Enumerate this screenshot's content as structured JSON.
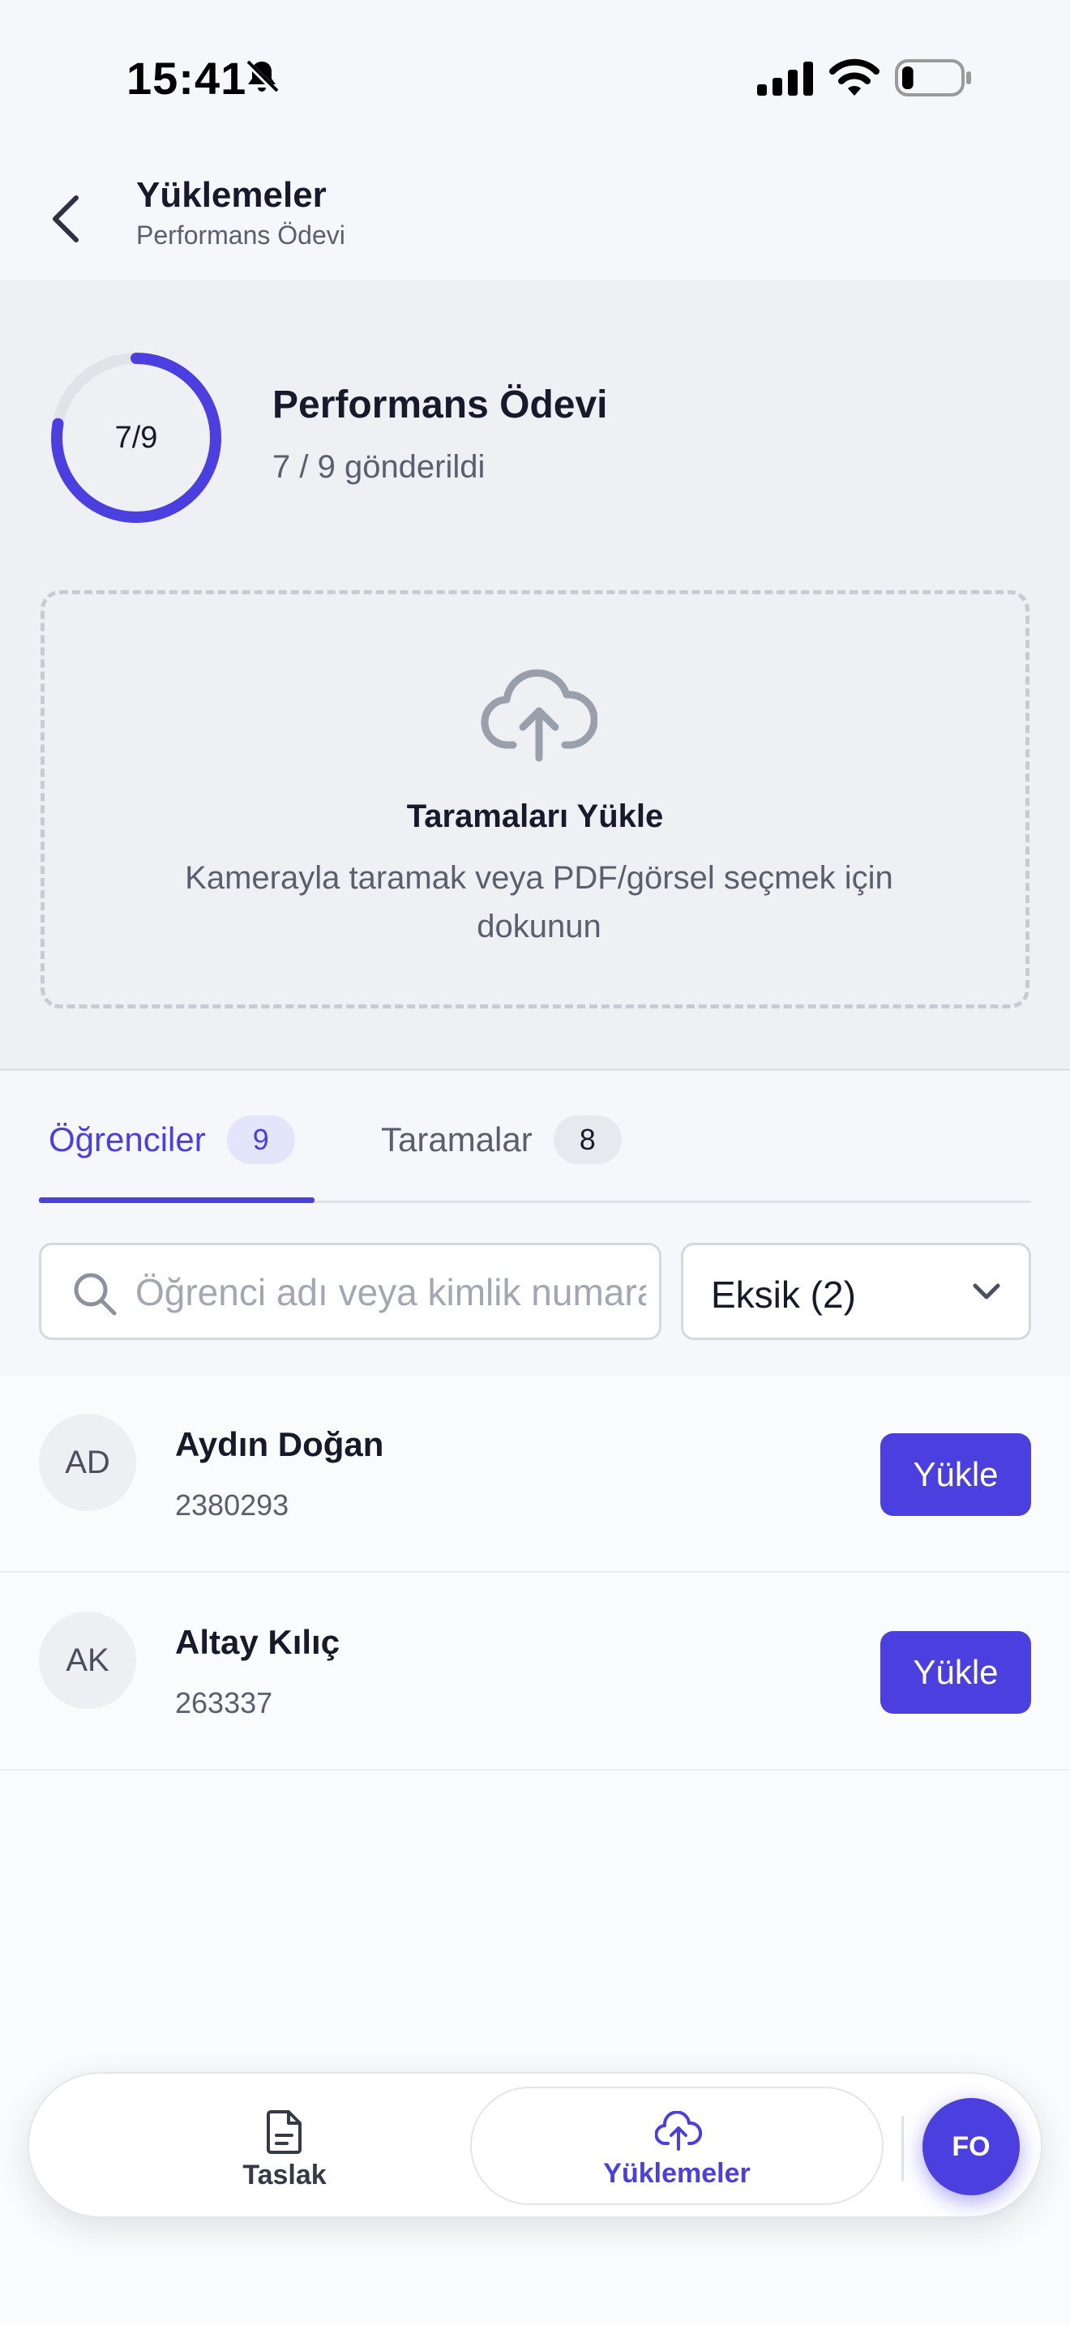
{
  "status_bar": {
    "time": "15:41",
    "battery_level": 0.2
  },
  "header": {
    "title": "Yüklemeler",
    "subtitle": "Performans Ödevi"
  },
  "summary": {
    "progress_label": "7/9",
    "submitted": 7,
    "total": 9,
    "title": "Performans Ödevi",
    "count_text": "7 / 9 gönderildi"
  },
  "upload_zone": {
    "title": "Taramaları Yükle",
    "description": "Kamerayla taramak veya PDF/görsel seçmek için dokunun"
  },
  "tabs": [
    {
      "label": "Öğrenciler",
      "badge": "9",
      "active": true
    },
    {
      "label": "Taramalar",
      "badge": "8",
      "active": false
    }
  ],
  "search": {
    "placeholder": "Öğrenci adı veya kimlik numarası",
    "value": ""
  },
  "filter": {
    "selected": "Eksik (2)"
  },
  "students": [
    {
      "initials": "AD",
      "name": "Aydın Doğan",
      "id": "2380293",
      "action": "Yükle"
    },
    {
      "initials": "AK",
      "name": "Altay Kılıç",
      "id": "263337",
      "action": "Yükle"
    }
  ],
  "bottom_nav": {
    "draft_label": "Taslak",
    "uploads_label": "Yüklemeler",
    "profile_initials": "FO",
    "active": "uploads"
  },
  "colors": {
    "accent": "#4b3fe0",
    "text": "#161a2b",
    "muted": "#5a5f6e"
  },
  "icons": [
    "bell-slash-icon",
    "signal-icon",
    "wifi-icon",
    "battery-icon",
    "back-icon",
    "cloud-upload-icon",
    "search-icon",
    "chevron-down-icon",
    "document-icon"
  ]
}
